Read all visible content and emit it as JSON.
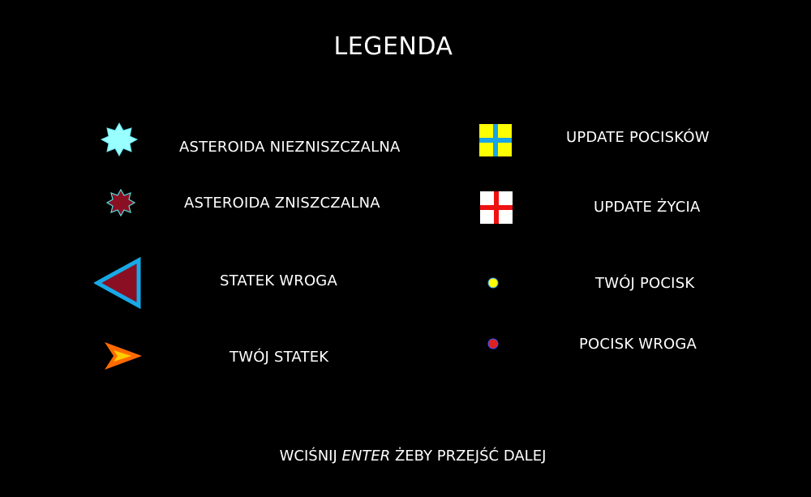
{
  "screen": {
    "title": "LEGENDA",
    "footer": {
      "before": "WCIŚNIJ ",
      "key": "ENTER",
      "after": " ŻEBY PRZEJŚĆ DALEJ"
    }
  },
  "legend": {
    "left": [
      {
        "icon": "indestructible-asteroid-icon",
        "label": "ASTEROIDA NIEZNISZCZALNA",
        "color": "#99ffff"
      },
      {
        "icon": "destructible-asteroid-icon",
        "label": "ASTEROIDA ZNISZCZALNA",
        "color": "#8a0f22"
      },
      {
        "icon": "enemy-ship-icon",
        "label": "STATEK WROGA",
        "color": "#8a0f22"
      },
      {
        "icon": "player-ship-icon",
        "label": "TWÓJ STATEK",
        "color": "#ff6a00"
      }
    ],
    "right": [
      {
        "icon": "ammo-update-icon",
        "label": "UPDATE POCISKÓW",
        "color": "#ffff00"
      },
      {
        "icon": "life-update-icon",
        "label": "UPDATE ŻYCIA",
        "color": "#ff0000"
      },
      {
        "icon": "player-bullet-icon",
        "label": "TWÓJ POCISK",
        "color": "#ffff00"
      },
      {
        "icon": "enemy-bullet-icon",
        "label": "POCISK WROGA",
        "color": "#dd2222"
      }
    ]
  },
  "colors": {
    "background": "#000000",
    "text": "#ffffff",
    "outline_cyan": "#17a9e6"
  }
}
